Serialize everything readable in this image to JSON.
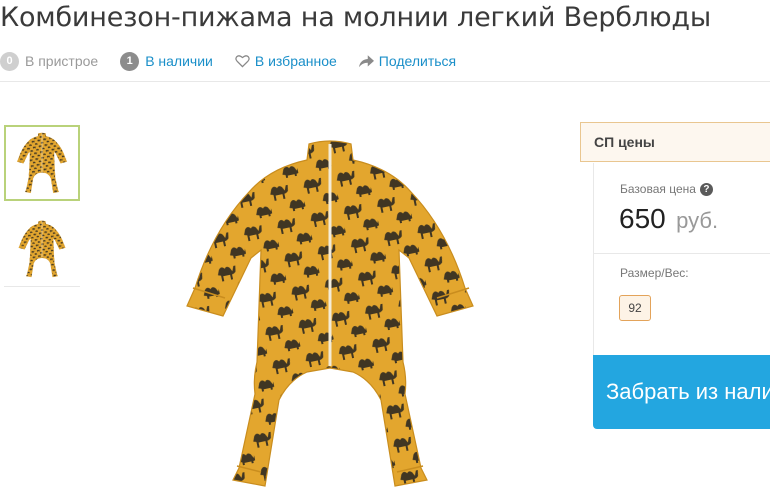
{
  "product": {
    "title": "Комбинезон-пижама на молнии легкий Верблюды"
  },
  "actions": {
    "compare": {
      "count": "0",
      "label": "В пристрое"
    },
    "stock": {
      "count": "1",
      "label": "В наличии"
    },
    "favorite": {
      "label": "В избранное",
      "icon": "heart-outline-icon"
    },
    "share": {
      "label": "Поделиться",
      "icon": "share-arrow-icon"
    }
  },
  "gallery": {
    "thumbnails": [
      "thumbnail-front",
      "thumbnail-back"
    ],
    "main_image": "pajama-jumpsuit-image"
  },
  "pricing": {
    "header": "СП цены",
    "base_label": "Базовая цена",
    "help_icon": "?",
    "price": "650",
    "currency": "руб.",
    "size_label": "Размер/Вес:",
    "sizes": [
      "92"
    ],
    "selected_size": "92",
    "buy_button": "Забрать из наличия"
  },
  "colors": {
    "accent_blue": "#23a6e0",
    "link_blue": "#1a8fc9",
    "garment_mustard": "#e3a62e",
    "panel_border": "#e9c690",
    "thumb_selected_border": "#b9d27a"
  }
}
